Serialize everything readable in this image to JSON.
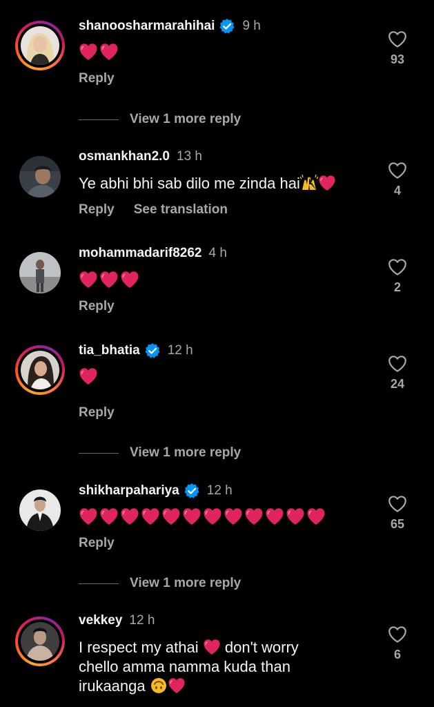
{
  "comments": [
    {
      "username": "shanoosharmarahihai",
      "verified": true,
      "time": "9 h",
      "hearts": 2,
      "likes": "93",
      "reply_label": "Reply",
      "more_replies": "View 1 more reply"
    },
    {
      "username": "osmankhan2.0",
      "verified": false,
      "time": "13 h",
      "text": "Ye abhi bhi sab dilo me zinda hai",
      "likes": "4",
      "reply_label": "Reply",
      "translation_label": "See translation"
    },
    {
      "username": "mohammadarif8262",
      "verified": false,
      "time": "4 h",
      "hearts": 3,
      "likes": "2",
      "reply_label": "Reply"
    },
    {
      "username": "tia_bhatia",
      "verified": true,
      "time": "12 h",
      "hearts": 1,
      "likes": "24",
      "reply_label": "Reply",
      "more_replies": "View 1 more reply"
    },
    {
      "username": "shikharpahariya",
      "verified": true,
      "time": "12 h",
      "hearts": 12,
      "likes": "65",
      "reply_label": "Reply",
      "more_replies": "View 1 more reply"
    },
    {
      "username": "vekkey",
      "verified": false,
      "time": "12 h",
      "text_line1_a": "I respect my athai",
      "text_line1_b": "don't worry",
      "text_line2": "chello amma namma kuda than",
      "text_line3": "irukaanga",
      "likes": "6"
    }
  ],
  "colors": {
    "background": "#000000",
    "text_primary": "#f5f5f5",
    "text_secondary": "#a8a8a8",
    "verified_blue": "#0095f6",
    "heart_red": "#e0245e"
  },
  "icons": {
    "like": "heart-outline-icon",
    "verified": "verified-badge-icon",
    "heart_emoji": "red-heart-emoji",
    "raising_hands_emoji": "raising-hands-emoji",
    "upside_down_emoji": "upside-down-face-emoji"
  }
}
